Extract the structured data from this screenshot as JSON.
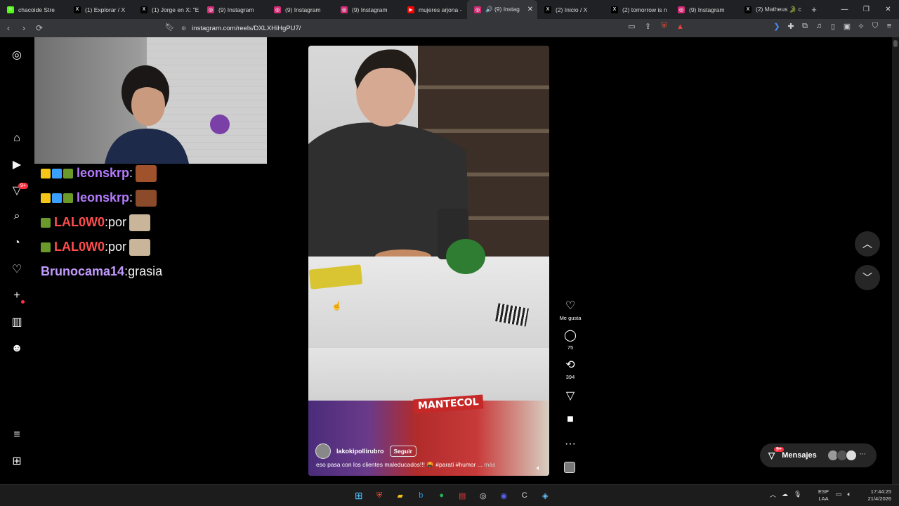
{
  "tabs": [
    {
      "label": "chacoide Stre",
      "fav_color": "#53fc18",
      "fav_text": "K"
    },
    {
      "label": "(1) Explorar / X",
      "fav_color": "#000000",
      "fav_text": "X"
    },
    {
      "label": "(1) Jorge en X: \"E",
      "fav_color": "#000000",
      "fav_text": "X"
    },
    {
      "label": "(9) Instagram",
      "fav_color": "#d62976",
      "fav_text": "◎"
    },
    {
      "label": "(9) Instagram",
      "fav_color": "#d62976",
      "fav_text": "◎"
    },
    {
      "label": "(9) Instagram",
      "fav_color": "#d62976",
      "fav_text": "◎"
    },
    {
      "label": "mujeres arjona -",
      "fav_color": "#ff0000",
      "fav_text": "▶"
    },
    {
      "label": "🔊 (9) Instag",
      "fav_color": "#d62976",
      "fav_text": "◎",
      "active": true
    },
    {
      "label": "(2) Inicio / X",
      "fav_color": "#000000",
      "fav_text": "X"
    },
    {
      "label": "(2) tomorrow is n",
      "fav_color": "#000000",
      "fav_text": "X"
    },
    {
      "label": "(9) Instagram",
      "fav_color": "#d62976",
      "fav_text": "◎"
    },
    {
      "label": "(2) Matheus 🐊 c",
      "fav_color": "#000000",
      "fav_text": "X"
    }
  ],
  "window_controls": {
    "minimize": "—",
    "maximize": "❐",
    "close": "✕"
  },
  "new_tab": "+",
  "address": {
    "url": "instagram.com/reels/DXLXHiHgPU7/"
  },
  "ig_nav": {
    "notifications_badge": "9+"
  },
  "chat": [
    {
      "user": "leonskrp",
      "user_color": "#b57bff",
      "msg": "",
      "badges": [
        "#f5c518",
        "#3aa0ff",
        "#6c9a2a"
      ],
      "emote_color": "#a0522d"
    },
    {
      "user": "leonskrp",
      "user_color": "#b57bff",
      "msg": "",
      "badges": [
        "#f5c518",
        "#3aa0ff",
        "#6c9a2a"
      ],
      "emote_color": "#8b4a2a"
    },
    {
      "user": "LAL0W0",
      "user_color": "#ff4d4d",
      "msg": " por",
      "badges": [
        "#6c9a2a"
      ],
      "emote_color": "#c8b59a"
    },
    {
      "user": "LAL0W0",
      "user_color": "#ff4d4d",
      "msg": " por",
      "badges": [
        "#6c9a2a"
      ],
      "emote_color": "#c8b59a"
    },
    {
      "user": "Brunocama14",
      "user_color": "#c39bff",
      "msg": " grasia",
      "badges": [],
      "emote_color": ""
    }
  ],
  "reel": {
    "username": "lakokipollirubro",
    "follow_label": "Seguir",
    "caption": "eso pasa con los clientes maleducados!!! 🤬 #parati #humor ...",
    "more_label": "más",
    "brand_text": "MANTECOL"
  },
  "actions": {
    "like_label": "Me gusta",
    "comments_count": "75",
    "reposts_count": "394"
  },
  "messages": {
    "label": "Mensajes",
    "badge": "9+"
  },
  "taskbar": {
    "lang_1": "ESP",
    "lang_2": "LAA",
    "time": "17:44:25",
    "date": "21/4/2026"
  }
}
